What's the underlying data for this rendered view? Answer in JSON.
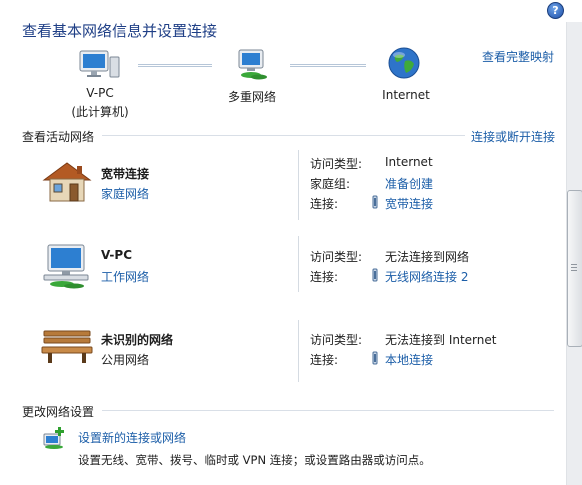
{
  "header": {
    "title": "查看基本网络信息并设置连接",
    "help_glyph": "?",
    "full_map_link": "查看完整映射"
  },
  "map": {
    "node1_name": "V-PC",
    "node1_sub": "(此计算机)",
    "node2_name": "多重网络",
    "node3_name": "Internet"
  },
  "active_networks": {
    "header": "查看活动网络",
    "connect_link": "连接或断开连接",
    "networks": [
      {
        "name": "宽带连接",
        "type": "家庭网络",
        "type_is_link": true,
        "icon": "house-icon",
        "rows": [
          {
            "key": "访问类型:",
            "value": "Internet",
            "link": false
          },
          {
            "key": "家庭组:",
            "value": "准备创建",
            "link": true
          },
          {
            "key": "连接:",
            "value": "宽带连接",
            "link": true
          }
        ]
      },
      {
        "name": "V-PC",
        "type": "工作网络",
        "type_is_link": true,
        "icon": "work-network-icon",
        "rows": [
          {
            "key": "访问类型:",
            "value": "无法连接到网络",
            "link": false
          },
          {
            "key": "连接:",
            "value": "无线网络连接 2",
            "link": true
          }
        ]
      },
      {
        "name": "未识别的网络",
        "type": "公用网络",
        "type_is_link": false,
        "icon": "park-bench-icon",
        "rows": [
          {
            "key": "访问类型:",
            "value": "无法连接到 Internet",
            "link": false
          },
          {
            "key": "连接:",
            "value": "本地连接",
            "link": true
          }
        ]
      }
    ]
  },
  "change_settings": {
    "header": "更改网络设置",
    "items": [
      {
        "title": "设置新的连接或网络",
        "desc": "设置无线、宽带、拨号、临时或 VPN 连接；或设置路由器或访问点。",
        "icon": "new-connection-icon"
      }
    ]
  },
  "colors": {
    "link": "#1c5ea8",
    "title": "#1f3f86"
  }
}
